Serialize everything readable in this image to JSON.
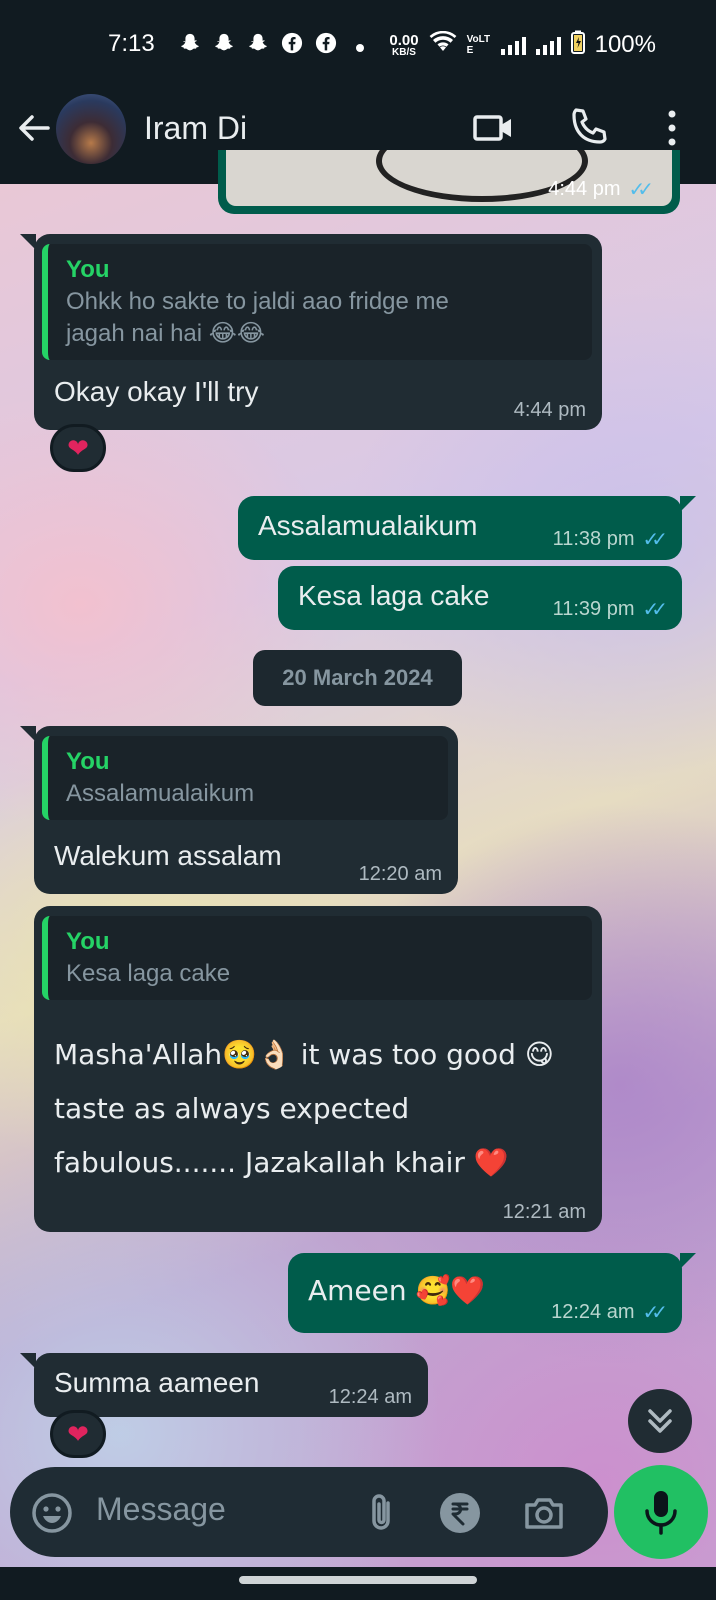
{
  "status_bar": {
    "time": "7:13",
    "net_speed_value": "0.00",
    "net_speed_unit": "KB/S",
    "volte_label": "VoLTE",
    "battery": "100%"
  },
  "header": {
    "contact_name": "Iram Di"
  },
  "top_partial": {
    "time": "4:44 pm"
  },
  "messages": [
    {
      "direction": "in",
      "quote_author": "You",
      "quote_text": "Ohkk ho sakte to jaldi aao fridge me jagah nai hai 😂😂",
      "text": "Okay okay I'll try",
      "time": "4:44 pm",
      "reaction": "❤"
    },
    {
      "direction": "out",
      "text": "Assalamualaikum",
      "time": "11:38 pm"
    },
    {
      "direction": "out",
      "text": "Kesa laga cake",
      "time": "11:39 pm"
    },
    {
      "direction": "in",
      "quote_author": "You",
      "quote_text": "Assalamualaikum",
      "text": "Walekum assalam",
      "time": "12:20 am"
    },
    {
      "direction": "in",
      "quote_author": "You",
      "quote_text": "Kesa laga cake",
      "text": "Masha'Allah🥹👌🏻 it was too good 😋 taste as always expected fabulous....... Jazakallah khair ❤️",
      "time": "12:21 am"
    },
    {
      "direction": "out",
      "text": "Ameen 🥰❤️",
      "time": "12:24 am"
    },
    {
      "direction": "in",
      "text": "Summa aameen",
      "time": "12:24 am",
      "reaction": "❤"
    }
  ],
  "date_separator": "20 March 2024",
  "composer": {
    "placeholder": "Message"
  },
  "colors": {
    "header_bg": "#111b21",
    "incoming_bubble": "#202c33",
    "outgoing_bubble": "#005c4b",
    "quote_accent": "#25d366",
    "read_ticks": "#53bdeb",
    "mic_button": "#21c063"
  },
  "icons": {
    "header": [
      "back-arrow-icon",
      "video-call-icon",
      "phone-icon",
      "more-vert-icon"
    ],
    "composer": [
      "emoji-icon",
      "attach-icon",
      "rupee-payment-icon",
      "camera-icon",
      "mic-icon"
    ],
    "scroll": "double-chevron-down-icon"
  }
}
